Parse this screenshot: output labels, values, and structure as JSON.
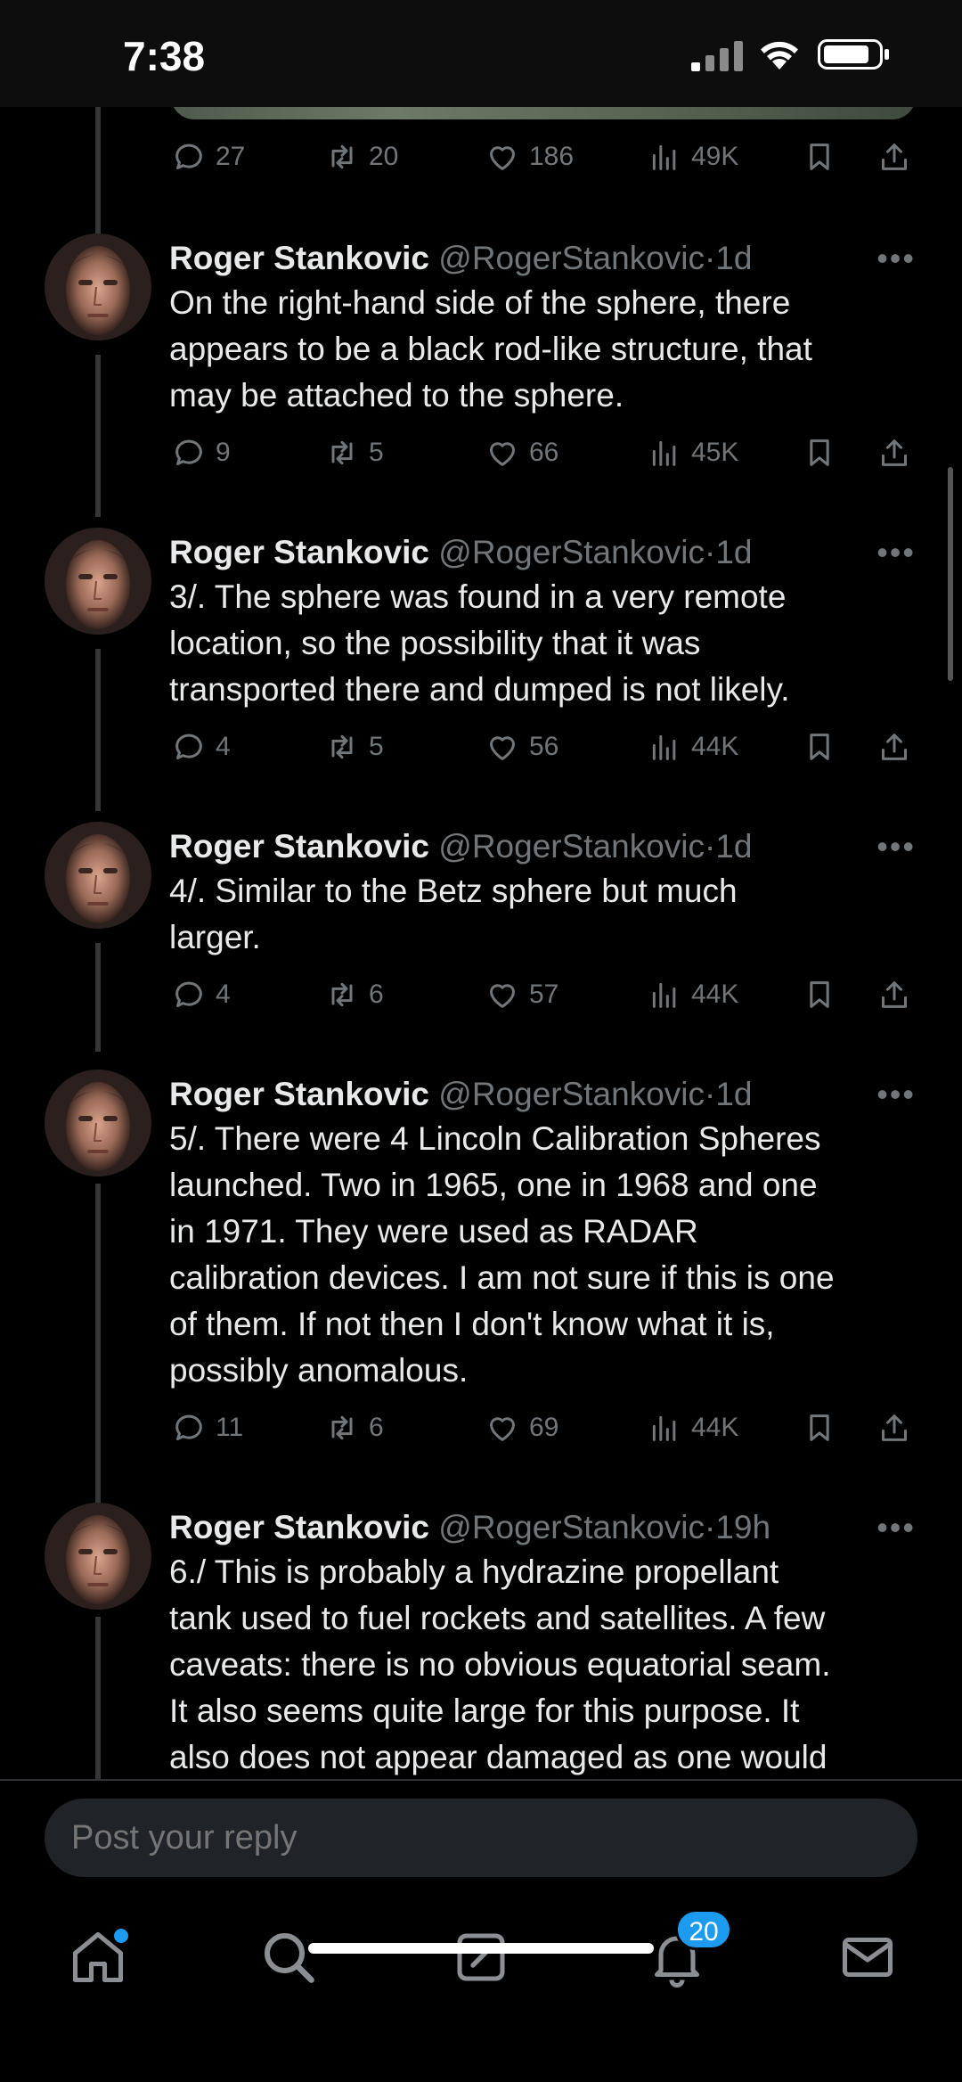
{
  "status_bar": {
    "time": "7:38"
  },
  "top_actions": {
    "replies": "27",
    "reposts": "20",
    "likes": "186",
    "views": "49K"
  },
  "tweets": [
    {
      "author": "Roger Stankovic",
      "handle": "@RogerStankovic",
      "sep": "·",
      "time": "1d",
      "lines": [
        "On the right-hand side of the sphere, there",
        "appears to be a black rod-like structure, that",
        "may be attached to the sphere."
      ],
      "replies": "9",
      "reposts": "5",
      "likes": "66",
      "views": "45K"
    },
    {
      "author": "Roger Stankovic",
      "handle": "@RogerStankovic",
      "sep": "·",
      "time": "1d",
      "lines": [
        "3/. The sphere was found in a very remote",
        "location, so the possibility that it was",
        "transported there and dumped is not likely."
      ],
      "replies": "4",
      "reposts": "5",
      "likes": "56",
      "views": "44K"
    },
    {
      "author": "Roger Stankovic",
      "handle": "@RogerStankovic",
      "sep": "·",
      "time": "1d",
      "lines": [
        "4/. Similar to the Betz sphere but much",
        "larger."
      ],
      "replies": "4",
      "reposts": "6",
      "likes": "57",
      "views": "44K"
    },
    {
      "author": "Roger Stankovic",
      "handle": "@RogerStankovic",
      "sep": "·",
      "time": "1d",
      "lines": [
        "5/. There were 4 Lincoln Calibration Spheres",
        "launched. Two in 1965, one in 1968 and one",
        "in 1971. They were used as RADAR",
        "calibration devices. I am not sure if this is one",
        "of them. If not then I don't know what it is,",
        "possibly anomalous."
      ],
      "replies": "11",
      "reposts": "6",
      "likes": "69",
      "views": "44K"
    },
    {
      "author": "Roger Stankovic",
      "handle": "@RogerStankovic",
      "sep": "·",
      "time": "19h",
      "lines": [
        "6./ This is probably a hydrazine propellant",
        "tank used to fuel rockets and satellites. A few",
        "caveats: there is no obvious equatorial seam.",
        "It also seems quite large for this purpose. It",
        "also does not appear damaged as one would"
      ]
    }
  ],
  "reply_bar": {
    "placeholder": "Post your reply"
  },
  "tab_bar": {
    "notifications_badge": "20"
  },
  "icons": [
    "reply-icon",
    "repost-icon",
    "like-icon",
    "views-icon",
    "bookmark-icon",
    "share-icon",
    "more-icon",
    "home-icon",
    "search-icon",
    "compose-icon",
    "notifications-icon",
    "messages-icon"
  ],
  "colors": {
    "background": "#000000",
    "text": "#e7e9ea",
    "muted": "#71767b",
    "accent": "#1d9bf0"
  }
}
